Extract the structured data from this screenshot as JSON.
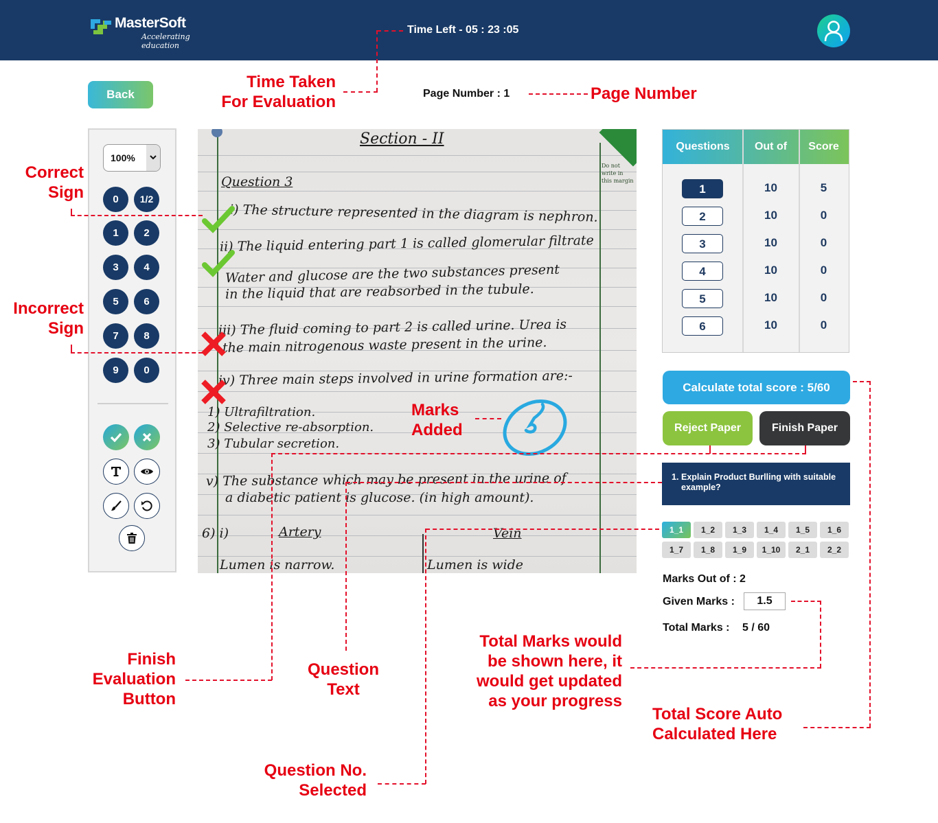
{
  "header": {
    "brand": "MasterSoft",
    "tagline": "Accelerating education",
    "timer_label": "Time Left - 05 : 23 :05",
    "profile_icon": "user-icon"
  },
  "toolbar": {
    "back_label": "Back",
    "page_number": "Page Number : 1"
  },
  "tools": {
    "zoom_value": "100%",
    "mark_buttons": [
      "0",
      "1/2",
      "1",
      "2",
      "3",
      "4",
      "5",
      "6",
      "7",
      "8",
      "9",
      "0"
    ],
    "actions": [
      {
        "name": "correct-sign",
        "icon": "check-icon"
      },
      {
        "name": "incorrect-sign",
        "icon": "cross-icon"
      },
      {
        "name": "text-tool",
        "icon": "text-icon"
      },
      {
        "name": "view-tool",
        "icon": "eye-icon"
      },
      {
        "name": "pen-tool",
        "icon": "brush-icon"
      },
      {
        "name": "undo-tool",
        "icon": "rotate-icon"
      },
      {
        "name": "delete-tool",
        "icon": "trash-icon"
      }
    ]
  },
  "sheet": {
    "heading": "Section - II",
    "question_label": "Question 3",
    "margin_note": "Do not write in this margin",
    "lines": [
      "i) The structure represented in the diagram is nephron.",
      "ii) The liquid entering part 1 is called glomerular filtrate",
      "Water and glucose are the two substances present",
      "in the liquid that are reabsorbed in the tubule.",
      "iii) The fluid coming to part 2 is called urine. Urea is",
      "the main nitrogenous waste present in the urine.",
      "iv) Three main steps involved in urine formation are:-",
      "1) Ultrafiltration.",
      "2) Selective re-absorption.",
      "3) Tubular secretion.",
      "v) The substance which may be present in the urine of",
      "a diabetic patient is glucose. (in high amount).",
      "6) i)",
      "Artery",
      "Vein",
      "Lumen is narrow.",
      "Lumen is wide"
    ],
    "marks_added": "5"
  },
  "score_table": {
    "headers": [
      "Questions",
      "Out of",
      "Score"
    ],
    "rows": [
      {
        "q": "1",
        "out_of": "10",
        "score": "5",
        "active": true
      },
      {
        "q": "2",
        "out_of": "10",
        "score": "0",
        "active": false
      },
      {
        "q": "3",
        "out_of": "10",
        "score": "0",
        "active": false
      },
      {
        "q": "4",
        "out_of": "10",
        "score": "0",
        "active": false
      },
      {
        "q": "5",
        "out_of": "10",
        "score": "0",
        "active": false
      },
      {
        "q": "6",
        "out_of": "10",
        "score": "0",
        "active": false
      }
    ]
  },
  "actions": {
    "calculate_label": "Calculate total score : 5/60",
    "reject_label": "Reject Paper",
    "finish_label": "Finish Paper"
  },
  "question": {
    "number": "1.",
    "text": "Explain Product Burlling with suitable example?"
  },
  "sub_questions": [
    "1_1",
    "1_2",
    "1_3",
    "1_4",
    "1_5",
    "1_6",
    "1_7",
    "1_8",
    "1_9",
    "1_10",
    "2_1",
    "2_2"
  ],
  "sub_question_selected": "1_1",
  "marks": {
    "out_of_label": "Marks Out of : 2",
    "given_label": "Given Marks :",
    "given_value": "1.5",
    "total_label": "Total Marks :",
    "total_value": "5 / 60"
  },
  "annotations": {
    "time_taken": [
      "Time Taken",
      "For Evaluation"
    ],
    "page_number": "Page Number",
    "correct_sign": [
      "Correct",
      "Sign"
    ],
    "incorrect_sign": [
      "Incorrect",
      "Sign"
    ],
    "marks_added": [
      "Marks",
      "Added"
    ],
    "finish_evaluation": [
      "Finish",
      "Evaluation",
      "Button"
    ],
    "question_text": [
      "Question",
      "Text"
    ],
    "total_marks": [
      "Total Marks would",
      "be shown here, it",
      "would get updated",
      "as your progress"
    ],
    "question_no": [
      "Question No.",
      "Selected"
    ],
    "total_score": [
      "Total Score Auto",
      "Calculated Here"
    ]
  },
  "colors": {
    "header_bg": "#193a66",
    "accent_blue": "#2fa9e1",
    "accent_green": "#8cc43f",
    "dark_button": "#363738",
    "annotation_red": "#e60012"
  }
}
